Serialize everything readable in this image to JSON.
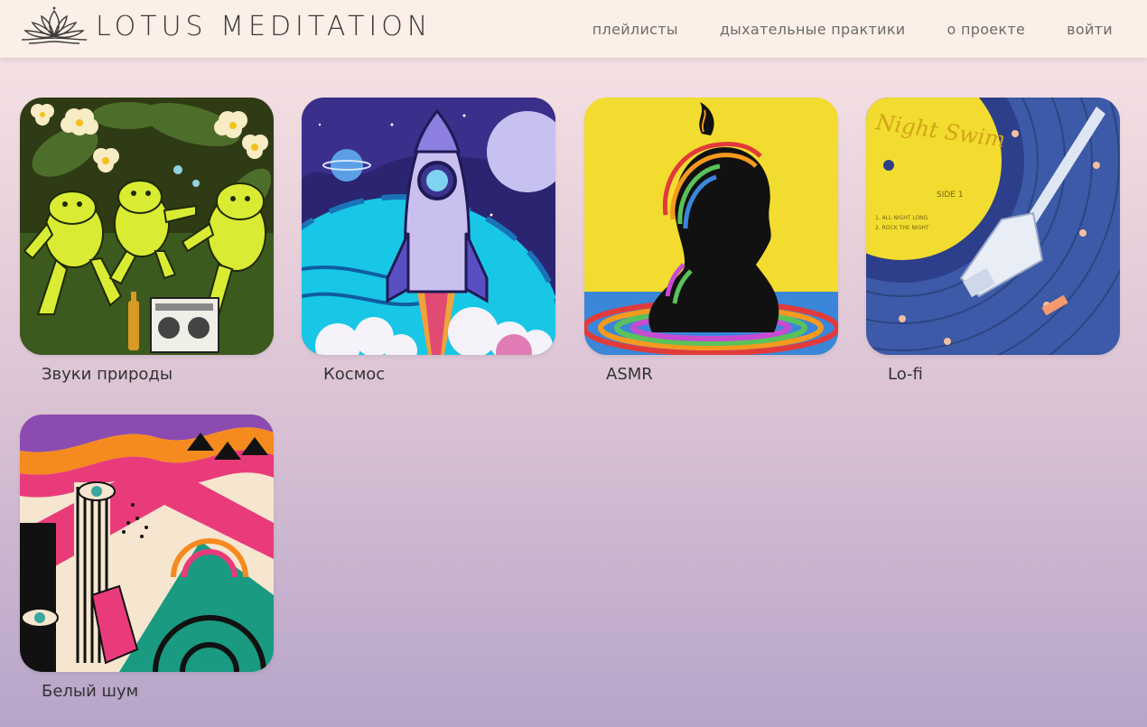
{
  "brand": {
    "name": "LOTUS MEDITATION"
  },
  "nav": {
    "items": [
      "плейлисты",
      "дыхательные практики",
      "о проекте",
      "войти"
    ]
  },
  "playlists": [
    {
      "title": "Звуки природы",
      "icon": "frogs-artwork"
    },
    {
      "title": "Космос",
      "icon": "rocket-artwork"
    },
    {
      "title": "ASMR",
      "icon": "head-artwork"
    },
    {
      "title": "Lo-fi",
      "icon": "vinyl-artwork"
    },
    {
      "title": "Белый шум",
      "icon": "psychedelic-artwork"
    }
  ],
  "vinyl": {
    "name": "Night Swim",
    "side": "SIDE 1",
    "tracks": [
      "1. ALL NIGHT LONG",
      "2. ROCK THE NIGHT"
    ]
  },
  "colors": {
    "header_bg": "#fcefe7",
    "background_top": "#f8e6e6",
    "background_bottom": "#b7a4c9"
  }
}
